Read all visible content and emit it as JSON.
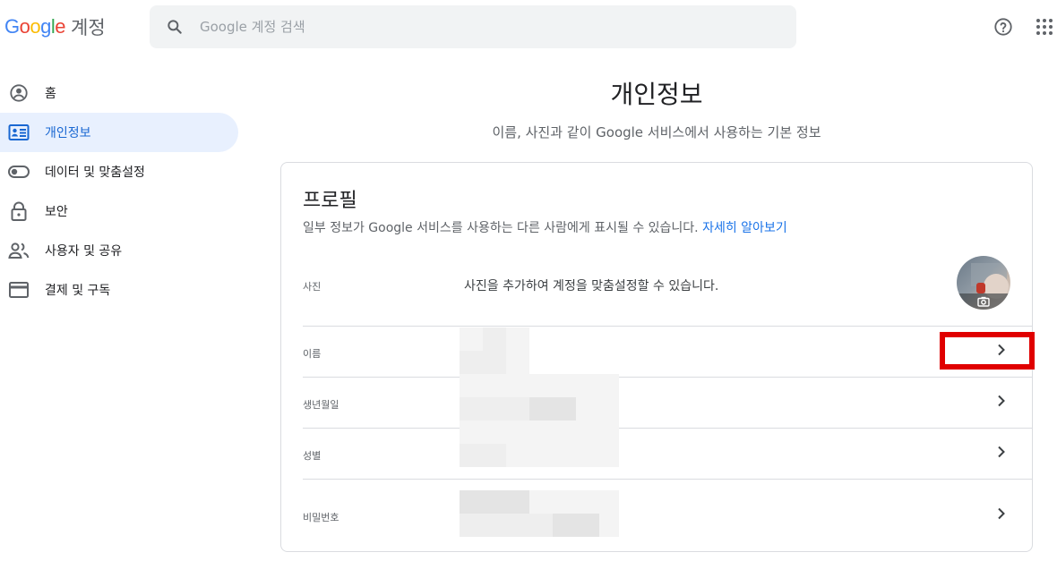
{
  "header": {
    "logo_letters": [
      "G",
      "o",
      "o",
      "g",
      "l",
      "e"
    ],
    "logo_colors": [
      "#4285F4",
      "#EA4335",
      "#FBBC05",
      "#4285F4",
      "#34A853",
      "#EA4335"
    ],
    "product_name": "계정",
    "search_placeholder": "Google 계정 검색"
  },
  "sidebar": {
    "items": [
      {
        "label": "홈",
        "icon": "account-circle-icon",
        "active": false
      },
      {
        "label": "개인정보",
        "icon": "id-card-icon",
        "active": true
      },
      {
        "label": "데이터 및 맞춤설정",
        "icon": "toggle-icon",
        "active": false
      },
      {
        "label": "보안",
        "icon": "lock-icon",
        "active": false
      },
      {
        "label": "사용자 및 공유",
        "icon": "people-icon",
        "active": false
      },
      {
        "label": "결제 및 구독",
        "icon": "credit-card-icon",
        "active": false
      }
    ]
  },
  "main": {
    "title": "개인정보",
    "subtitle": "이름, 사진과 같이 Google 서비스에서 사용하는 기본 정보",
    "card": {
      "title": "프로필",
      "description": "일부 정보가 Google 서비스를 사용하는 다른 사람에게 표시될 수 있습니다.",
      "learn_more": "자세히 알아보기",
      "rows": [
        {
          "label": "사진",
          "value": "사진을 추가하여 계정을 맞춤설정할 수 있습니다."
        },
        {
          "label": "이름",
          "value": ""
        },
        {
          "label": "생년월일",
          "value": ""
        },
        {
          "label": "성별",
          "value": ""
        },
        {
          "label": "비밀번호",
          "value": ""
        }
      ]
    }
  },
  "colors": {
    "accent": "#1a73e8",
    "active_bg": "#e8f0fe",
    "highlight": "#e00000"
  }
}
